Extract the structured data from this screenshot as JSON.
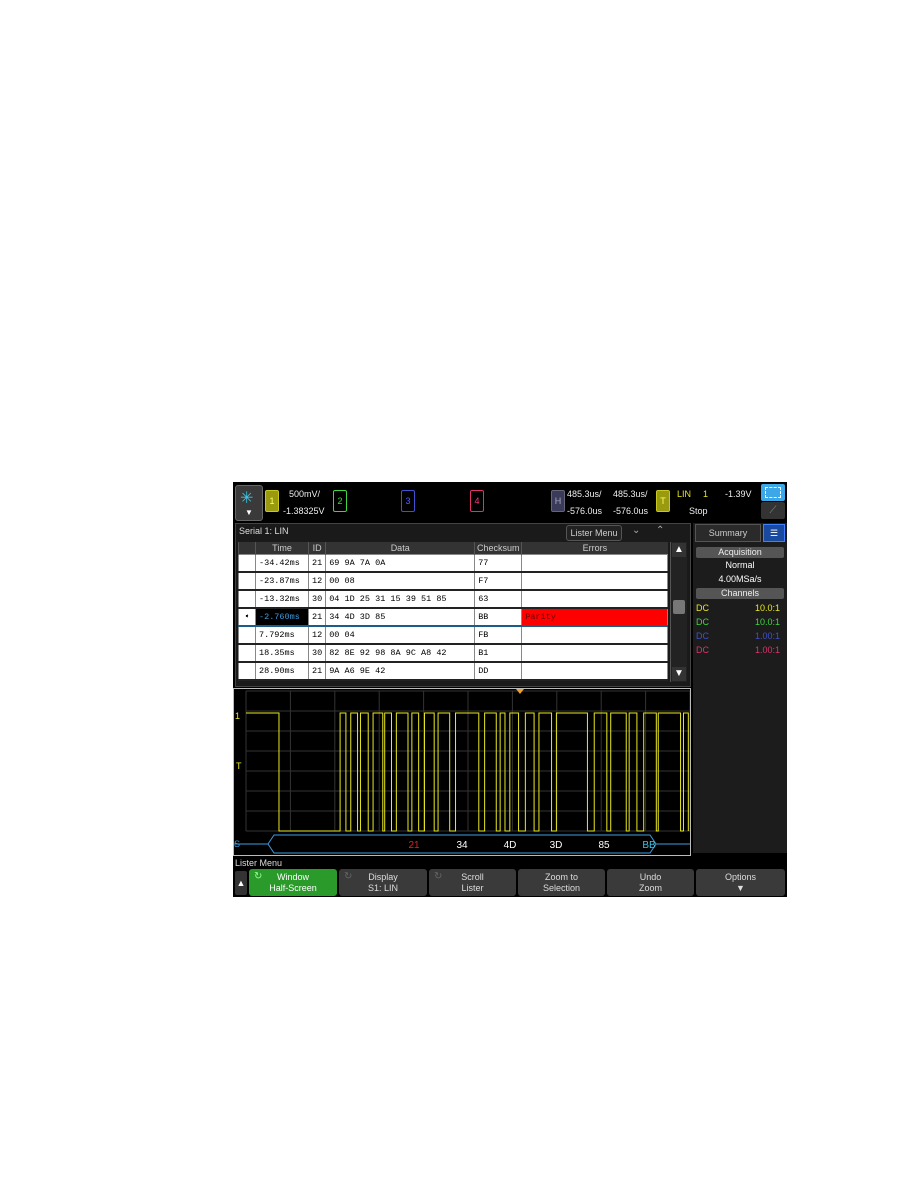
{
  "topbar": {
    "ch1_label": "1",
    "ch1_scale": "500mV/",
    "ch1_offset": "-1.38325V",
    "ch2_label": "2",
    "ch3_label": "3",
    "ch4_label": "4",
    "h_label": "H",
    "h_scale1": "485.3us/",
    "h_delay1": "-576.0us",
    "h_scale2": "485.3us/",
    "h_delay2": "-576.0us",
    "t_label": "T",
    "trig_type": "LIN",
    "trig_source": "1",
    "trig_level": "-1.39V",
    "run_state": "Stop"
  },
  "lister": {
    "title": "Serial 1: LIN",
    "menu_label": "Lister Menu",
    "columns": [
      "Time",
      "ID",
      "Data",
      "Checksum",
      "Errors"
    ],
    "rows": [
      {
        "time": "-34.42ms",
        "id": "21",
        "data": "69 9A 7A 0A",
        "checksum": "77",
        "errors": ""
      },
      {
        "time": "-23.87ms",
        "id": "12",
        "data": "00 08",
        "checksum": "F7",
        "errors": ""
      },
      {
        "time": "-13.32ms",
        "id": "30",
        "data": "04 1D 25 31 15 39 51 85",
        "checksum": "63",
        "errors": ""
      },
      {
        "time": "-2.760ms",
        "id": "21",
        "data": "34 4D 3D 85",
        "checksum": "BB",
        "errors": "Parity",
        "selected": true
      },
      {
        "time": "7.792ms",
        "id": "12",
        "data": "00 04",
        "checksum": "FB",
        "errors": ""
      },
      {
        "time": "18.35ms",
        "id": "30",
        "data": "82 8E 92 98 8A 9C A8 42",
        "checksum": "B1",
        "errors": ""
      },
      {
        "time": "28.90ms",
        "id": "21",
        "data": "9A A6 9E 42",
        "checksum": "DD",
        "errors": ""
      }
    ],
    "scroll_position": 0.45
  },
  "summary": {
    "tab_label": "Summary",
    "acq_header": "Acquisition",
    "acq_mode": "Normal",
    "sample_rate": "4.00MSa/s",
    "channels_header": "Channels",
    "channels": [
      {
        "coupling": "DC",
        "probe": "10.0:1",
        "color": "#e8e820"
      },
      {
        "coupling": "DC",
        "probe": "10.0:1",
        "color": "#3fd63f"
      },
      {
        "coupling": "DC",
        "probe": "1.00:1",
        "color": "#4050d0"
      },
      {
        "coupling": "DC",
        "probe": "1.00:1",
        "color": "#e03070"
      }
    ]
  },
  "waveform": {
    "ch_marker": "1",
    "trig_marker": "T",
    "bus_marker": "S",
    "decode_bytes": [
      {
        "value": "21",
        "color": "#e02020"
      },
      {
        "value": "34",
        "color": "#ffffff"
      },
      {
        "value": "4D",
        "color": "#ffffff"
      },
      {
        "value": "3D",
        "color": "#ffffff"
      },
      {
        "value": "85",
        "color": "#ffffff"
      },
      {
        "value": "BB",
        "color": "#3cc6e8"
      }
    ]
  },
  "softkeys": {
    "menu_title": "Lister Menu",
    "keys": [
      {
        "line1": "Window",
        "line2": "Half-Screen"
      },
      {
        "line1": "Display",
        "line2": "S1: LIN"
      },
      {
        "line1": "Scroll",
        "line2": "Lister"
      },
      {
        "line1": "Zoom to",
        "line2": "Selection"
      },
      {
        "line1": "Undo",
        "line2": "Zoom"
      },
      {
        "line1": "Options",
        "line2": "▼"
      }
    ]
  }
}
